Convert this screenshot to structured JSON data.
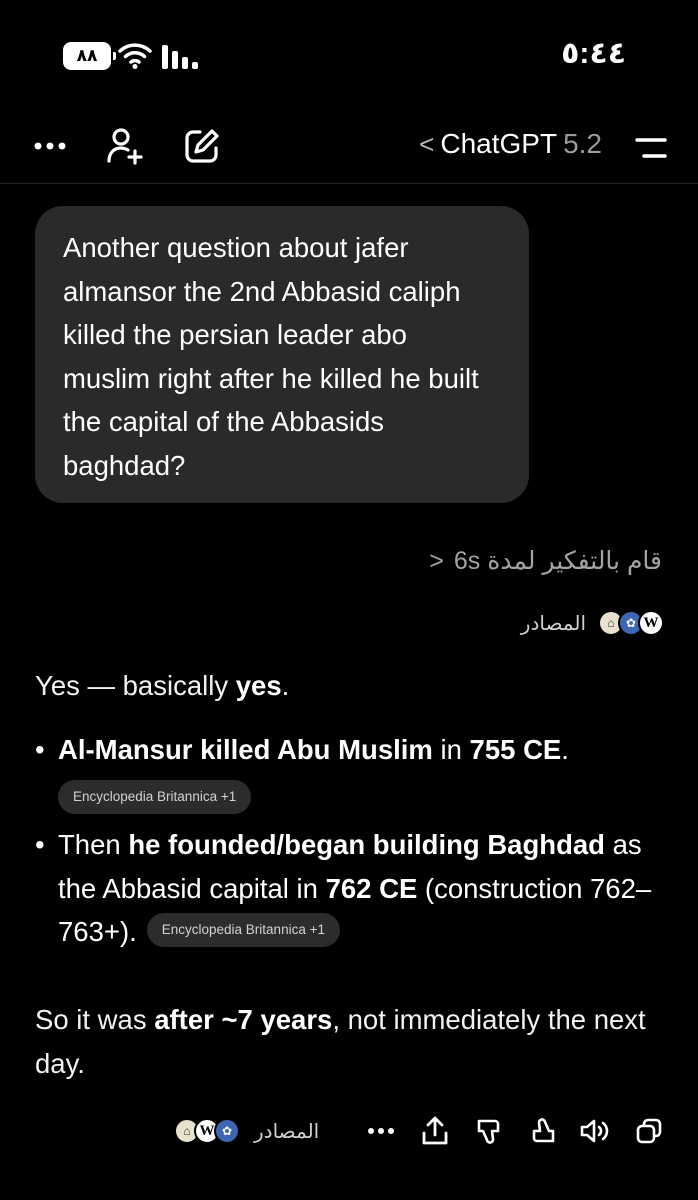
{
  "status_bar": {
    "battery": "٨٨",
    "time": "٥:٤٤"
  },
  "header": {
    "back_chevron": "<",
    "title": "ChatGPT",
    "version": "5.2",
    "icons": [
      "more-dots-icon",
      "add-person-icon",
      "new-chat-icon",
      "menu-icon"
    ]
  },
  "user_message": "Another question about jafer almansor the 2nd Abbasid caliph killed the persian leader abo muslim right after he killed he built the capital of the Abbasids baghdad?",
  "assistant": {
    "thinking": "قام بالتفكير لمدة 6s",
    "thinking_chevron": "<",
    "sources_label": "المصادر",
    "intro": {
      "plain": "Yes — basically ",
      "bold": "yes",
      "end": "."
    },
    "bullets": [
      {
        "b1": "Al-Mansur killed Abu Muslim",
        "p1": " in ",
        "b2": "755 CE",
        "p2": ".",
        "chip": "Encyclopedia Britannica +1"
      },
      {
        "p0": "Then ",
        "b1": "he founded/began building Baghdad",
        "p1": " as the Abbasid capital in ",
        "b2": "762 CE",
        "p2": " (construction 762–763+).",
        "chip": "Encyclopedia Britannica +1"
      }
    ],
    "closing": {
      "p0": "So it was ",
      "b1": "after ~7 years",
      "p1": ", not immediately the next day."
    }
  },
  "action_bar": {
    "sources_label": "المصادر",
    "icons": [
      "copy-icon",
      "read-aloud-icon",
      "thumbs-up-icon",
      "thumbs-down-icon",
      "share-icon",
      "more-dots-icon"
    ]
  }
}
